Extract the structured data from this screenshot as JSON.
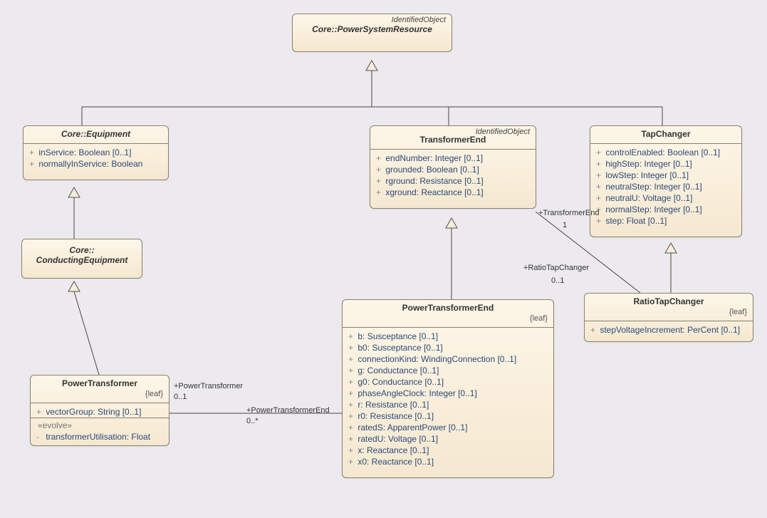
{
  "chart_data": {
    "type": "uml-class-diagram",
    "classes": [
      {
        "id": "PowerSystemResource",
        "name": "Core::PowerSystemResource",
        "stereotype": "IdentifiedObject",
        "abstract": true
      },
      {
        "id": "Equipment",
        "name": "Core::Equipment",
        "abstract": true,
        "attributes": [
          {
            "vis": "+",
            "text": "inService: Boolean [0..1]"
          },
          {
            "vis": "+",
            "text": "normallyInService: Boolean"
          }
        ]
      },
      {
        "id": "TransformerEnd",
        "name": "TransformerEnd",
        "stereotype": "IdentifiedObject",
        "attributes": [
          {
            "vis": "+",
            "text": "endNumber: Integer [0..1]"
          },
          {
            "vis": "+",
            "text": "grounded: Boolean [0..1]"
          },
          {
            "vis": "+",
            "text": "rground: Resistance [0..1]"
          },
          {
            "vis": "+",
            "text": "xground: Reactance [0..1]"
          }
        ]
      },
      {
        "id": "TapChanger",
        "name": "TapChanger",
        "attributes": [
          {
            "vis": "+",
            "text": "controlEnabled: Boolean [0..1]"
          },
          {
            "vis": "+",
            "text": "highStep: Integer [0..1]"
          },
          {
            "vis": "+",
            "text": "lowStep: Integer [0..1]"
          },
          {
            "vis": "+",
            "text": "neutralStep: Integer [0..1]"
          },
          {
            "vis": "+",
            "text": "neutralU: Voltage [0..1]"
          },
          {
            "vis": "+",
            "text": "normalStep: Integer [0..1]"
          },
          {
            "vis": "+",
            "text": "step: Float [0..1]"
          }
        ]
      },
      {
        "id": "ConductingEquipment",
        "name": "Core::\nConductingEquipment",
        "abstract": true
      },
      {
        "id": "RatioTapChanger",
        "name": "RatioTapChanger",
        "leaf": true,
        "attributes": [
          {
            "vis": "+",
            "text": "stepVoltageIncrement: PerCent [0..1]"
          }
        ]
      },
      {
        "id": "PowerTransformerEnd",
        "name": "PowerTransformerEnd",
        "leaf": true,
        "attributes": [
          {
            "vis": "+",
            "text": "b: Susceptance [0..1]"
          },
          {
            "vis": "+",
            "text": "b0: Susceptance [0..1]"
          },
          {
            "vis": "+",
            "text": "connectionKind: WindingConnection [0..1]"
          },
          {
            "vis": "+",
            "text": "g: Conductance [0..1]"
          },
          {
            "vis": "+",
            "text": "g0: Conductance [0..1]"
          },
          {
            "vis": "+",
            "text": "phaseAngleClock: Integer [0..1]"
          },
          {
            "vis": "+",
            "text": "r: Resistance [0..1]"
          },
          {
            "vis": "+",
            "text": "r0: Resistance [0..1]"
          },
          {
            "vis": "+",
            "text": "ratedS: ApparentPower [0..1]"
          },
          {
            "vis": "+",
            "text": "ratedU: Voltage [0..1]"
          },
          {
            "vis": "+",
            "text": "x: Reactance [0..1]"
          },
          {
            "vis": "+",
            "text": "x0: Reactance [0..1]"
          }
        ]
      },
      {
        "id": "PowerTransformer",
        "name": "PowerTransformer",
        "leaf": true,
        "attributes": [
          {
            "vis": "+",
            "text": "vectorGroup: String [0..1]"
          }
        ],
        "evolve": [
          {
            "vis": "-",
            "text": "transformerUtilisation: Float"
          }
        ]
      }
    ],
    "inheritance": [
      {
        "child": "Equipment",
        "parent": "PowerSystemResource"
      },
      {
        "child": "TransformerEnd",
        "parent": "PowerSystemResource"
      },
      {
        "child": "TapChanger",
        "parent": "PowerSystemResource"
      },
      {
        "child": "ConductingEquipment",
        "parent": "Equipment"
      },
      {
        "child": "PowerTransformer",
        "parent": "ConductingEquipment"
      },
      {
        "child": "PowerTransformerEnd",
        "parent": "TransformerEnd"
      },
      {
        "child": "RatioTapChanger",
        "parent": "TapChanger"
      }
    ],
    "associations": [
      {
        "endA": {
          "class": "PowerTransformer",
          "role": "+PowerTransformer",
          "mult": "0..1"
        },
        "endB": {
          "class": "PowerTransformerEnd",
          "role": "+PowerTransformerEnd",
          "mult": "0..*"
        }
      },
      {
        "endA": {
          "class": "TransformerEnd",
          "role": "+TransformerEnd",
          "mult": "1"
        },
        "endB": {
          "class": "RatioTapChanger",
          "role": "+RatioTapChanger",
          "mult": "0..1"
        }
      }
    ]
  },
  "labels": {
    "identifiedObject": "IdentifiedObject",
    "leaf": "{leaf}",
    "evolve": "«evolve»",
    "assoc_pt_role": "+PowerTransformer",
    "assoc_pt_mult": "0..1",
    "assoc_pte_role": "+PowerTransformerEnd",
    "assoc_pte_mult": "0..*",
    "assoc_te_role": "+TransformerEnd",
    "assoc_te_mult": "1",
    "assoc_rtc_role": "+RatioTapChanger",
    "assoc_rtc_mult": "0..1"
  }
}
